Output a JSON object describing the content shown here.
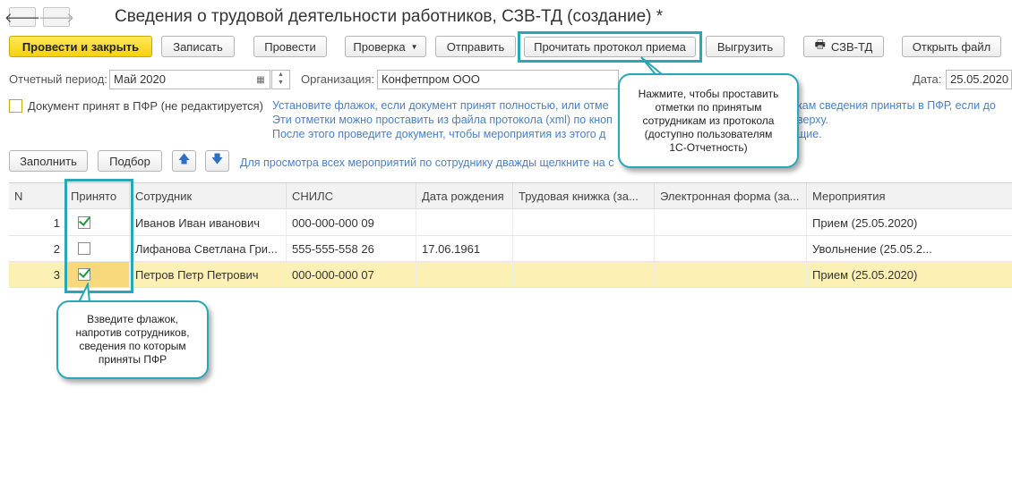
{
  "window": {
    "title": "Сведения о трудовой деятельности работников, СЗВ-ТД (создание) *",
    "back_icon": "arrow-left",
    "forward_icon": "arrow-right"
  },
  "toolbar": {
    "post_close": "Провести и закрыть",
    "save": "Записать",
    "post": "Провести",
    "check": "Проверка",
    "send": "Отправить",
    "read_protocol": "Прочитать протокол приема",
    "upload": "Выгрузить",
    "print": "СЗВ-ТД",
    "open_file": "Открыть файл"
  },
  "header": {
    "period_label": "Отчетный период:",
    "period_value": "Май 2020",
    "org_label": "Организация:",
    "org_value": "Конфетпром ООО",
    "date_label": "Дата:",
    "date_value": "25.05.2020",
    "accepted_label": "Документ принят в ПФР (не редактируется)"
  },
  "hints": {
    "line1a": "Установите флажок, если документ принят полностью, или отме",
    "line1b": "кам сведения приняты в ПФР, если до",
    "line2a": "Эти отметки можно проставить из файла протокола (xml) по кноп",
    "line2b": "верху.",
    "line3a": "После этого проведите документ, чтобы мероприятия из этого д",
    "line3b": "щие.",
    "table_hint": "Для просмотра всех мероприятий по сотруднику дважды щелкните на с"
  },
  "table_toolbar": {
    "fill": "Заполнить",
    "select": "Подбор"
  },
  "table": {
    "columns": [
      "N",
      "Принято",
      "Сотрудник",
      "СНИЛС",
      "Дата рождения",
      "Трудовая книжка (за...",
      "Электронная форма (за...",
      "Мероприятия"
    ],
    "rows": [
      {
        "n": "1",
        "accepted": true,
        "employee": "Иванов Иван иванович",
        "snils": "000-000-000 09",
        "birth": "",
        "book": "",
        "eform": "",
        "events": "Прием (25.05.2020)"
      },
      {
        "n": "2",
        "accepted": false,
        "employee": "Лифанова Светлана Гри...",
        "snils": "555-555-558 26",
        "birth": "17.06.1961",
        "book": "",
        "eform": "",
        "events": "Увольнение (25.05.2..."
      },
      {
        "n": "3",
        "accepted": true,
        "employee": "Петров Петр Петрович",
        "snils": "000-000-000 07",
        "birth": "",
        "book": "",
        "eform": "",
        "events": "Прием (25.05.2020)"
      }
    ]
  },
  "callouts": {
    "top": [
      "Нажмите, чтобы проставить",
      "отметки по принятым",
      "сотрудникам из протокола",
      "(доступно пользователям",
      "1С-Отчетность)"
    ],
    "bottom": [
      "Взведите флажок,",
      "напротив сотрудников,",
      "сведения по которым",
      "приняты ПФР"
    ]
  },
  "colors": {
    "accent": "#2aa7b7",
    "primary_button": "#f5d10f",
    "selected_row": "#fdf0b4",
    "hint_text": "#4b80c3",
    "check": "#1c9a3c"
  }
}
